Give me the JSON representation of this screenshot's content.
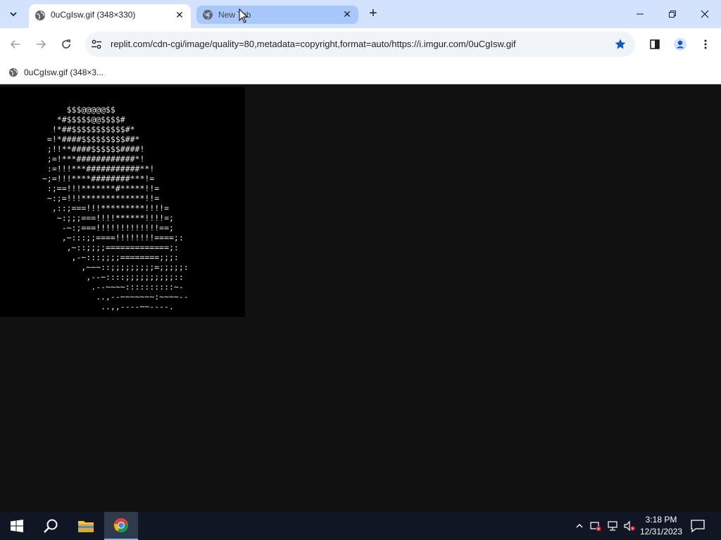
{
  "tabs": [
    {
      "title": "0uCgIsw.gif (348×330)",
      "active": true
    },
    {
      "title": "New Tab",
      "active": false
    }
  ],
  "toolbar": {
    "url": "replit.com/cdn-cgi/image/quality=80,metadata=copyright,format=auto/https://i.imgur.com/0uCgIsw.gif",
    "bookmarked": true
  },
  "bookmark_bar": {
    "items": [
      {
        "label": "0uCgIsw.gif (348×3..."
      }
    ]
  },
  "content": {
    "ascii_art": "     $$$@@@@@$$\n   *#$$$$$@@$$$$#\n  !*##$$$$$$$$$$$#*\n =!*####$$$$$$$$$##*\n ;!!**####$$$$$$####!\n ;=!***############*!\n :=!!!***###########**!\n~;=!!!****########***!=\n :;==!!!*******#*****!!=\n ~:;=!!!*************!!=\n  ,::;===!!!*********!!!!=\n   ~:;;;===!!!!******!!!!=;\n    -~:;===!!!!!!!!!!!!!==;\n    ,~:::;;====!!!!!!!!====;:\n     ,~::;;;;=============;:\n      ,-~:::;;;;========;;;:\n        ,~~~::;;;;;;;;;=;;;;;:\n         ,--~::::;;;;;;;;;;::\n          .--~~~~::::::::::~-\n           ..,--~~~~~~~:~~~~--\n            ..,,----~~----."
  },
  "taskbar": {
    "time": "3:18 PM",
    "date": "12/31/2023"
  },
  "colors": {
    "tab_strip": "#d3e3fd",
    "accent": "#0b57d0",
    "page_background": "#111111",
    "taskbar": "#101623"
  }
}
